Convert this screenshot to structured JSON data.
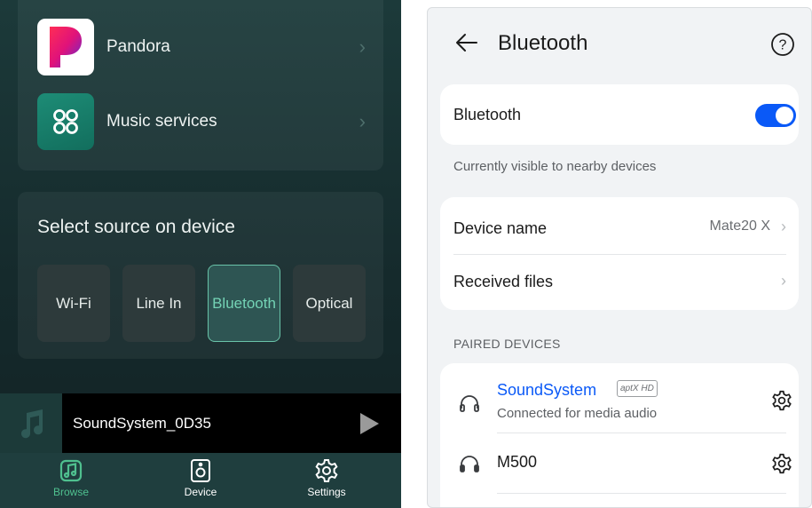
{
  "left_app": {
    "services": [
      {
        "label": "Pandora",
        "icon": "pandora-logo-icon"
      },
      {
        "label": "Music services",
        "icon": "music-services-icon"
      }
    ],
    "source": {
      "title": "Select source on device",
      "options": [
        {
          "label": "Wi-Fi",
          "selected": false
        },
        {
          "label": "Line In",
          "selected": false
        },
        {
          "label": "Bluetooth",
          "selected": true
        },
        {
          "label": "Optical",
          "selected": false
        }
      ]
    },
    "player": {
      "track": "SoundSystem_0D35",
      "icon": "play-icon"
    },
    "tabs": [
      {
        "label": "Browse",
        "icon": "music-note-icon",
        "active": true
      },
      {
        "label": "Device",
        "icon": "speaker-icon",
        "active": false
      },
      {
        "label": "Settings",
        "icon": "gear-icon",
        "active": false
      }
    ],
    "colors": {
      "accent": "#74d3b5",
      "tab_active": "#4fc08f"
    }
  },
  "settings": {
    "title": "Bluetooth",
    "bluetooth_toggle": {
      "label": "Bluetooth",
      "enabled": true
    },
    "visible_note": "Currently visible to nearby devices",
    "device_name": {
      "label": "Device name",
      "value": "Mate20 X"
    },
    "received_files": {
      "label": "Received files"
    },
    "paired_header": "PAIRED DEVICES",
    "paired_devices": [
      {
        "name": "SoundSystem",
        "badge": "aptX HD",
        "status": "Connected for media audio",
        "connected": true
      },
      {
        "name": "M500",
        "connected": false
      }
    ],
    "colors": {
      "toggle_on": "#0a59f7",
      "connected_name": "#0a59f7"
    }
  }
}
